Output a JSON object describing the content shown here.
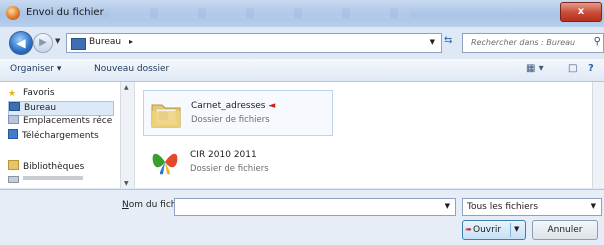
{
  "window": {
    "title": "Envoi du fichier",
    "close_glyph": "x"
  },
  "address": {
    "crumb": "Bureau",
    "search_placeholder": "Rechercher dans : Bureau"
  },
  "toolbar": {
    "organize": "Organiser ▾",
    "new_folder": "Nouveau dossier"
  },
  "nav": {
    "items": [
      {
        "label": "Favoris",
        "icon": "star-icon"
      },
      {
        "label": "Bureau",
        "icon": "desktop-icon",
        "selected": true
      },
      {
        "label": "Emplacements réce",
        "icon": "recent-places-icon"
      },
      {
        "label": "Téléchargements",
        "icon": "downloads-icon"
      },
      {
        "label": "Bibliothèques",
        "icon": "libraries-icon"
      }
    ]
  },
  "files": [
    {
      "name": "Carnet_adresses",
      "kind": "Dossier de fichiers",
      "marker": "◄",
      "icon": "folder-icon"
    },
    {
      "name": "CIR 2010 2011",
      "kind": "Dossier de fichiers",
      "icon": "butterfly-folder-icon"
    }
  ],
  "bottom": {
    "filename_label_prefix": "N",
    "filename_label_rest": "om du fichier :",
    "filename_value": "",
    "filter_value": "Tous les fichiers",
    "open_label": "Ouvrir",
    "cancel_label": "Annuler"
  }
}
